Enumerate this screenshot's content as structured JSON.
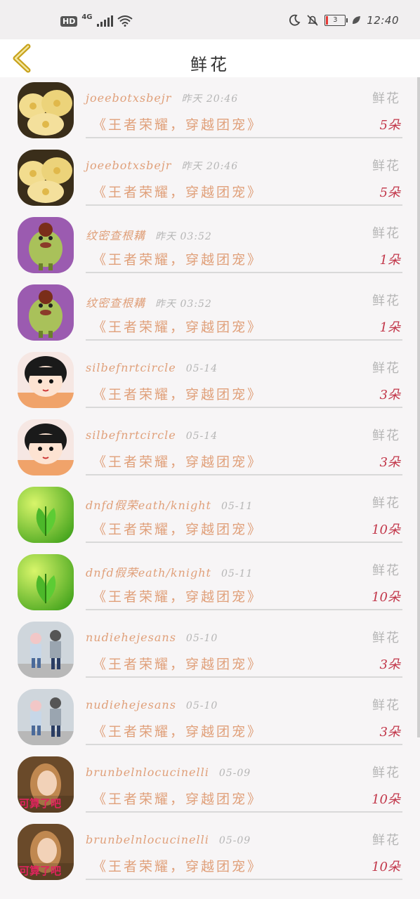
{
  "status_bar": {
    "hd": "HD",
    "network": "4G",
    "battery": "3",
    "time": "12:40"
  },
  "header": {
    "title": "鲜花"
  },
  "items": [
    {
      "name": "joeebotxsbejr",
      "time": "昨天 20:46",
      "gift": "鲜花",
      "room": "《王者荣耀，穿越团宠》",
      "count": "5朵",
      "avatar": "food-avatar"
    },
    {
      "name": "joeebotxsbejr",
      "time": "昨天 20:46",
      "gift": "鲜花",
      "room": "《王者荣耀，穿越团宠》",
      "count": "5朵",
      "avatar": "food-avatar"
    },
    {
      "name": "纹密查根耩",
      "time": "昨天 03:52",
      "gift": "鲜花",
      "room": "《王者荣耀，穿越团宠》",
      "count": "1朵",
      "avatar": "cartoon-frog-avatar"
    },
    {
      "name": "纹密查根耩",
      "time": "昨天 03:52",
      "gift": "鲜花",
      "room": "《王者荣耀，穿越团宠》",
      "count": "1朵",
      "avatar": "cartoon-frog-avatar"
    },
    {
      "name": "silbefnrtcircle",
      "time": "05-14",
      "gift": "鲜花",
      "room": "《王者荣耀，穿越团宠》",
      "count": "3朵",
      "avatar": "cartoon-girl-avatar"
    },
    {
      "name": "silbefnrtcircle",
      "time": "05-14",
      "gift": "鲜花",
      "room": "《王者荣耀，穿越团宠》",
      "count": "3朵",
      "avatar": "cartoon-girl-avatar"
    },
    {
      "name": "dnfd假荣eath/knight",
      "time": "05-11",
      "gift": "鲜花",
      "room": "《王者荣耀，穿越团宠》",
      "count": "10朵",
      "avatar": "green-leaf-avatar"
    },
    {
      "name": "dnfd假荣eath/knight",
      "time": "05-11",
      "gift": "鲜花",
      "room": "《王者荣耀，穿越团宠》",
      "count": "10朵",
      "avatar": "green-leaf-avatar"
    },
    {
      "name": "nudiehejesans",
      "time": "05-10",
      "gift": "鲜花",
      "room": "《王者荣耀，穿越团宠》",
      "count": "3朵",
      "avatar": "kids-photo-avatar"
    },
    {
      "name": "nudiehejesans",
      "time": "05-10",
      "gift": "鲜花",
      "room": "《王者荣耀，穿越团宠》",
      "count": "3朵",
      "avatar": "kids-photo-avatar"
    },
    {
      "name": "brunbelnlocucinelli",
      "time": "05-09",
      "gift": "鲜花",
      "room": "《王者荣耀，穿越团宠》",
      "count": "10朵",
      "avatar": "woman-photo-avatar",
      "avatar_text": "可算了吧"
    },
    {
      "name": "brunbelnlocucinelli",
      "time": "05-09",
      "gift": "鲜花",
      "room": "《王者荣耀，穿越团宠》",
      "count": "10朵",
      "avatar": "woman-photo-avatar",
      "avatar_text": "可算了吧"
    }
  ],
  "colors": {
    "name": "#e0a07a",
    "time": "#b5b5b5",
    "count": "#c2374a",
    "back_arrow": "#c8a21c"
  }
}
